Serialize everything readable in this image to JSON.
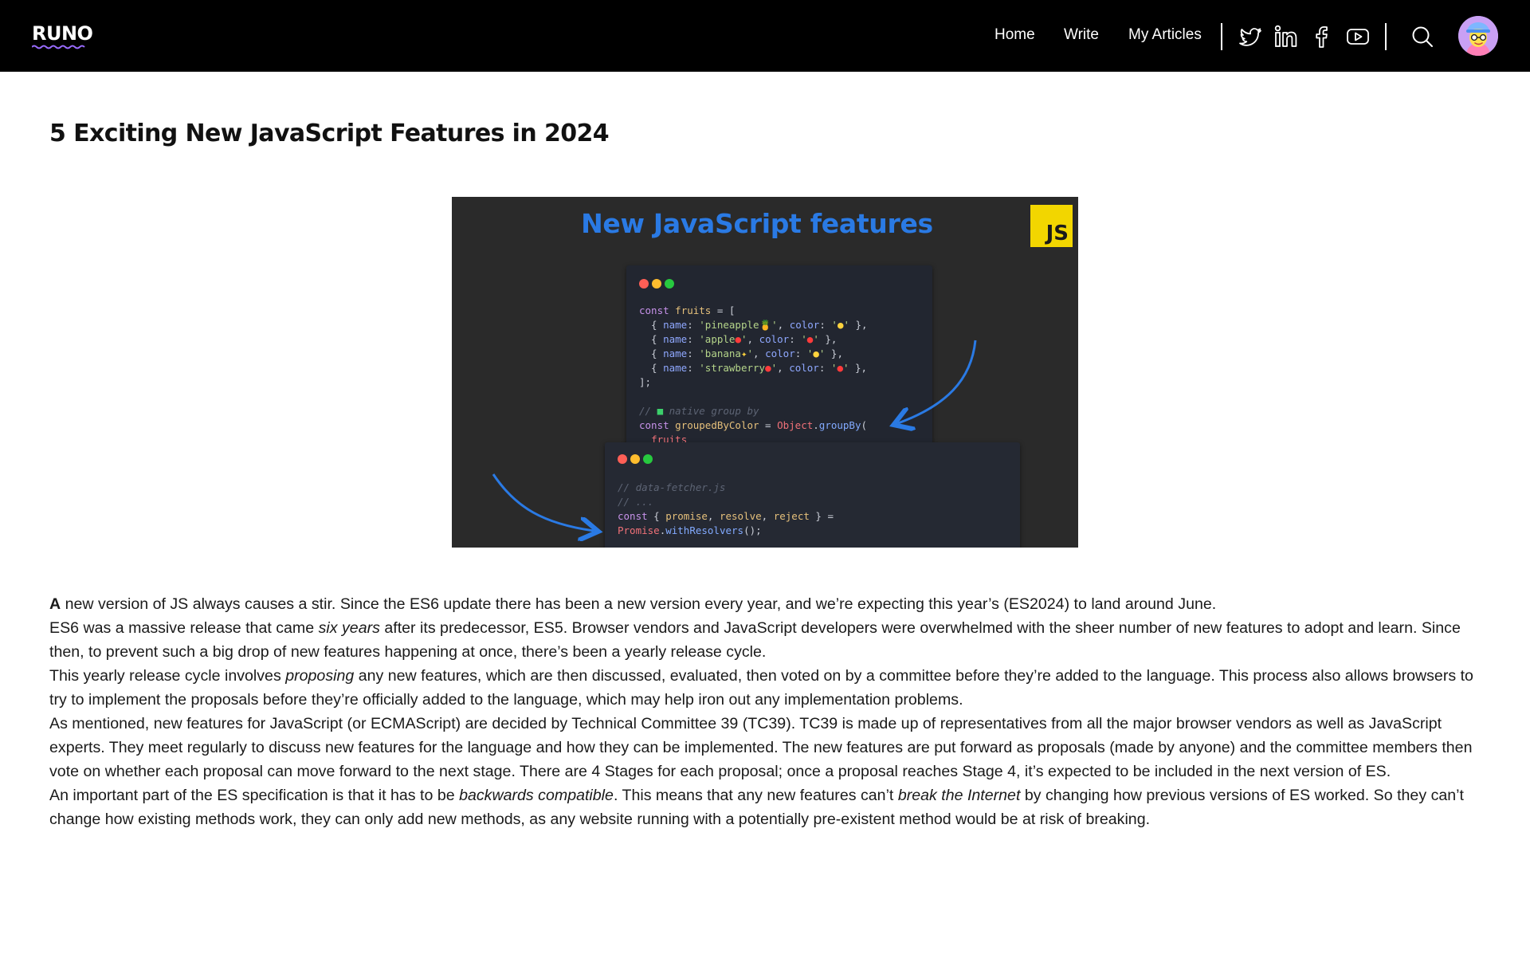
{
  "header": {
    "logo": "RUNO",
    "nav": [
      {
        "label": "Home"
      },
      {
        "label": "Write"
      },
      {
        "label": "My Articles"
      }
    ],
    "social_icons": [
      "twitter-icon",
      "linkedin-icon",
      "facebook-icon",
      "youtube-icon"
    ],
    "search_icon": "search-icon",
    "avatar": "user-avatar"
  },
  "article": {
    "title": "5 Exciting New JavaScript Features in 2024",
    "hero": {
      "heading": "New JavaScript features",
      "badge": "JS"
    },
    "paragraphs": [
      {
        "lead": "A",
        "p0_rest": " new version of JS always causes a stir. Since the ES6 update there has been a new version every year, and we’re expecting this year’s (ES2024) to land around June."
      },
      {
        "a": "ES6 was a massive release that came ",
        "em": "six years",
        "b": " after its predecessor, ES5. Browser vendors and JavaScript developers were overwhelmed with the sheer number of new features to adopt and learn. Since then, to prevent such a big drop of new features happening at once, there’s been a yearly release cycle."
      },
      {
        "a": "This yearly release cycle involves ",
        "em": "proposing",
        "b": " any new features, which are then discussed, evaluated, then voted on by a committee before they’re added to the language. This process also allows browsers to try to implement the proposals before they’re officially added to the language, which may help iron out any implementation problems."
      },
      {
        "text": "As mentioned, new features for JavaScript (or ECMAScript) are decided by Technical Committee 39 (TC39). TC39 is made up of representatives from all the major browser vendors as well as JavaScript experts. They meet regularly to discuss new features for the language and how they can be implemented. The new features are put forward as proposals (made by anyone) and the committee members then vote on whether each proposal can move forward to the next stage. There are 4 Stages for each proposal; once a proposal reaches Stage 4, it’s expected to be included in the next version of ES."
      },
      {
        "a": "An important part of the ES specification is that it has to be ",
        "em1": "backwards compatible",
        "b": ". This means that any new features can’t ",
        "em2": "break the Internet",
        "c": " by changing how previous versions of ES worked. So they can’t change how existing methods work, they can only add new methods, as any website running with a potentially pre-existent method would be at risk of breaking."
      }
    ]
  }
}
